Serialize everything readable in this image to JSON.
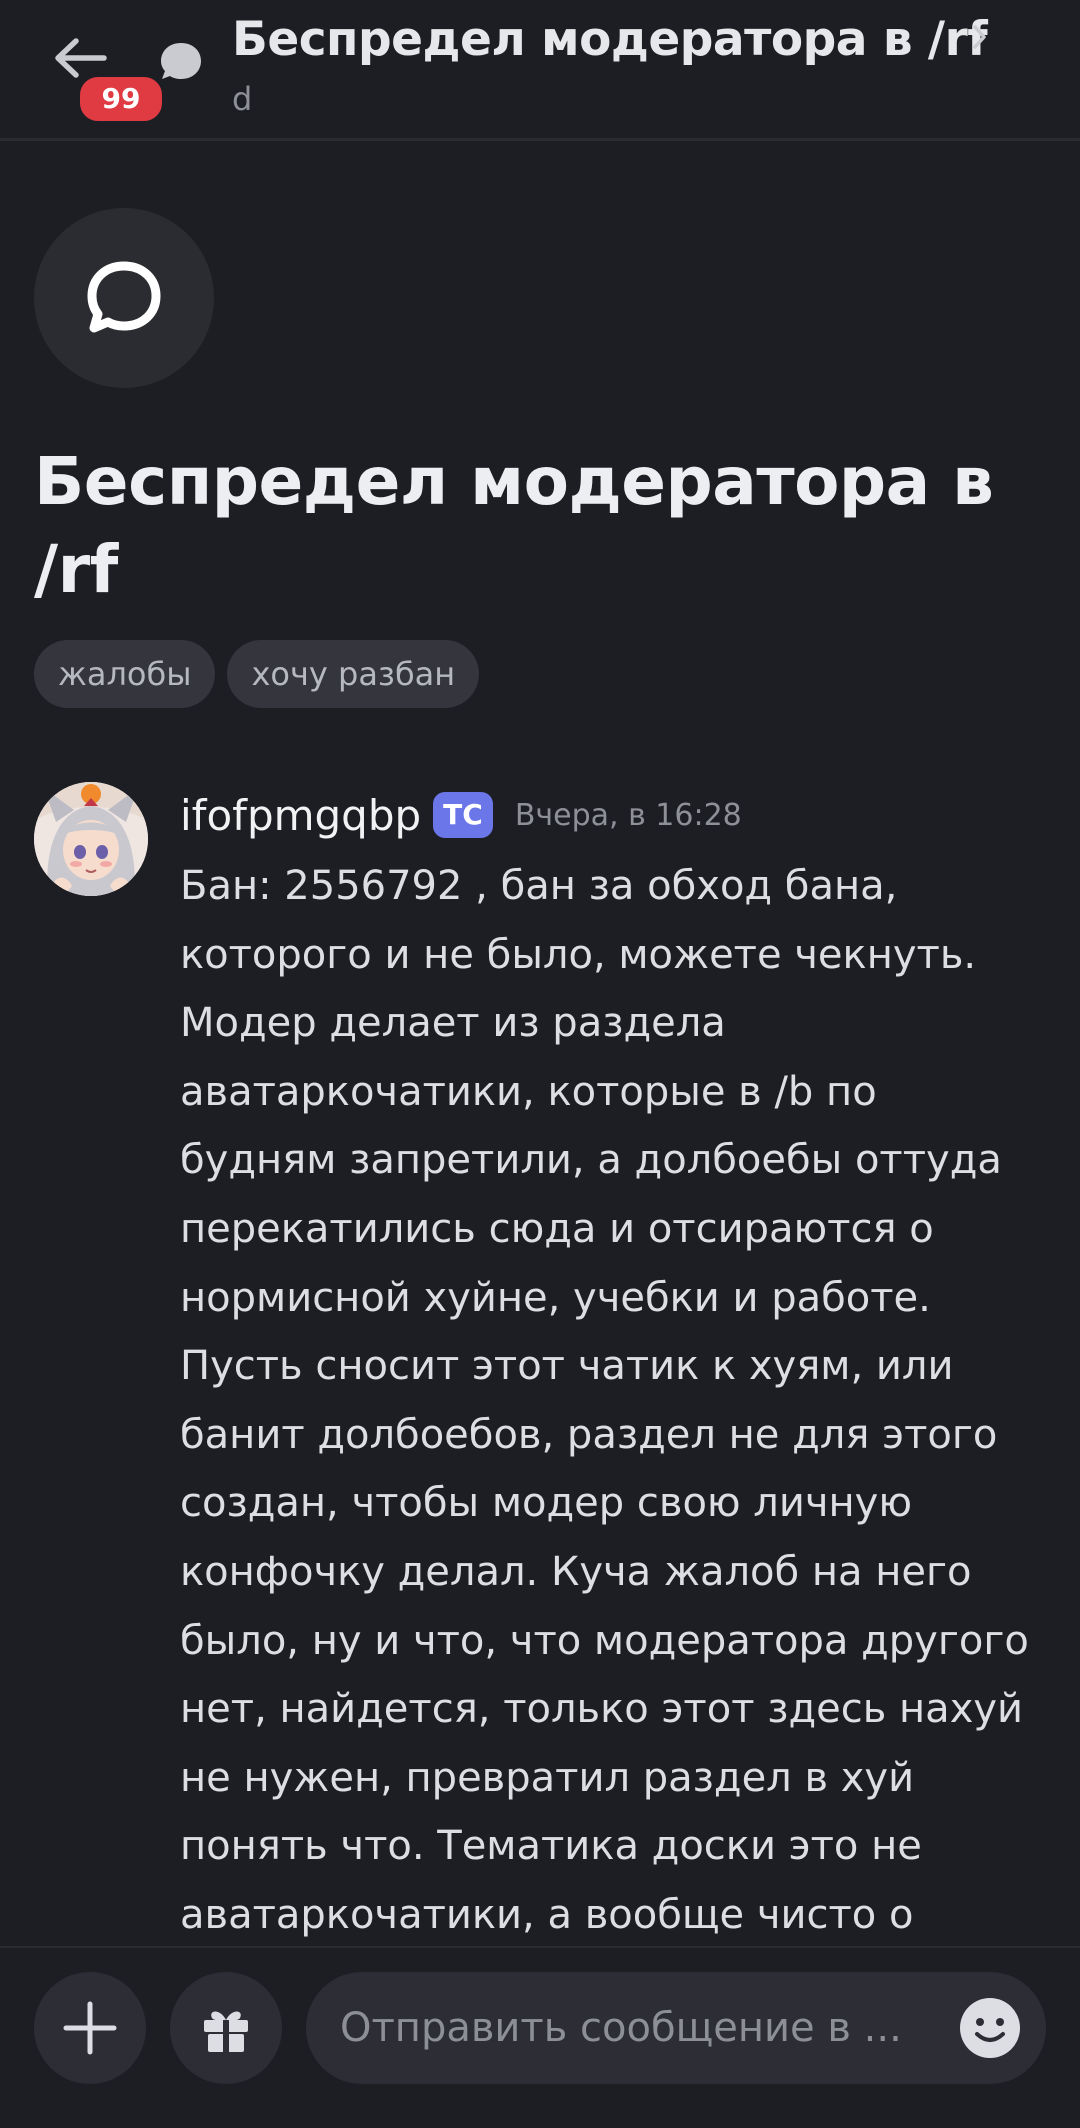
{
  "header": {
    "unread_badge": "99",
    "title": "Беспредел модератора в /rf",
    "subtitle": "d"
  },
  "thread": {
    "title": "Беспредел модератора в /rf",
    "tags": [
      "жалобы",
      "хочу разбан"
    ]
  },
  "message": {
    "author": "ifofpmgqbp",
    "op_badge": "ТС",
    "timestamp": "Вчера, в 16:28",
    "text": "Бан: 2556792 , бан за обход бана,\nкоторого и не было, можете чекнуть.\nМодер делает из раздела\nаватаркочатики, которые в /b по\nбудням запретили, а долбоебы оттуда\nперекатились сюда и отсираются о\nнормисной хуйне, учебки и работе.\nПусть сносит этот чатик к хуям, или\nбанит долбоебов, раздел не для этого\nсоздан, чтобы модер свою личную\nконфочку делал. Куча жалоб на него\nбыло, ну и что, что модератора другого\nнет, найдется, только этот здесь нахуй\nне нужен, превратил раздел в хуй\nпонять что. Тематика доски это не\nаватаркочатики, а вообще чисто о"
  },
  "composer": {
    "placeholder": "Отправить сообщение в ..."
  },
  "colors": {
    "background": "#1d1e23",
    "surface": "#2d2e35",
    "badge_red": "#e03a43",
    "op_badge": "#6b76e8"
  },
  "icons": {
    "back": "arrow-left-icon",
    "thread": "speech-bubble-icon",
    "chevron": "chevron-right-icon",
    "add": "plus-icon",
    "gift": "gift-icon",
    "emoji": "emoji-smile-icon"
  }
}
